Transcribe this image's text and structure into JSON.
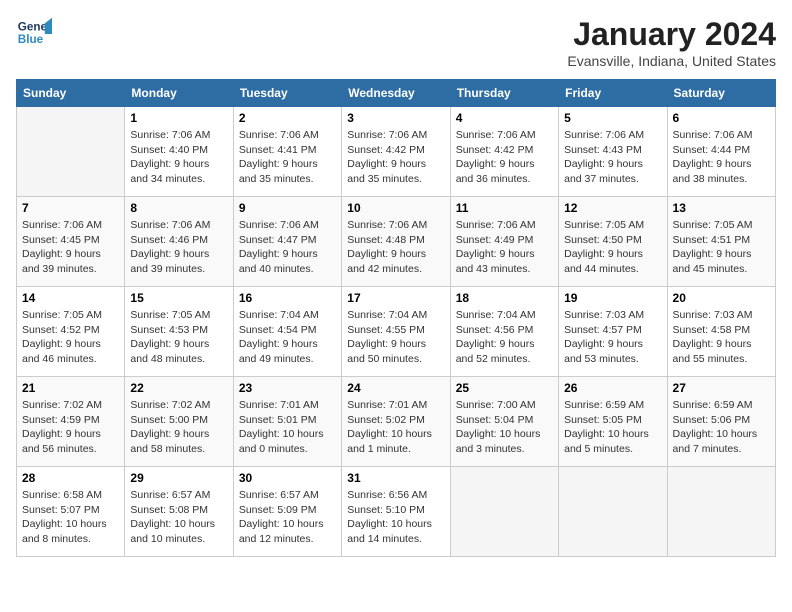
{
  "logo": {
    "line1": "General",
    "line2": "Blue"
  },
  "title": "January 2024",
  "subtitle": "Evansville, Indiana, United States",
  "weekdays": [
    "Sunday",
    "Monday",
    "Tuesday",
    "Wednesday",
    "Thursday",
    "Friday",
    "Saturday"
  ],
  "weeks": [
    [
      {
        "day": "",
        "info": ""
      },
      {
        "day": "1",
        "info": "Sunrise: 7:06 AM\nSunset: 4:40 PM\nDaylight: 9 hours\nand 34 minutes."
      },
      {
        "day": "2",
        "info": "Sunrise: 7:06 AM\nSunset: 4:41 PM\nDaylight: 9 hours\nand 35 minutes."
      },
      {
        "day": "3",
        "info": "Sunrise: 7:06 AM\nSunset: 4:42 PM\nDaylight: 9 hours\nand 35 minutes."
      },
      {
        "day": "4",
        "info": "Sunrise: 7:06 AM\nSunset: 4:42 PM\nDaylight: 9 hours\nand 36 minutes."
      },
      {
        "day": "5",
        "info": "Sunrise: 7:06 AM\nSunset: 4:43 PM\nDaylight: 9 hours\nand 37 minutes."
      },
      {
        "day": "6",
        "info": "Sunrise: 7:06 AM\nSunset: 4:44 PM\nDaylight: 9 hours\nand 38 minutes."
      }
    ],
    [
      {
        "day": "7",
        "info": ""
      },
      {
        "day": "8",
        "info": "Sunrise: 7:06 AM\nSunset: 4:46 PM\nDaylight: 9 hours\nand 39 minutes."
      },
      {
        "day": "9",
        "info": "Sunrise: 7:06 AM\nSunset: 4:47 PM\nDaylight: 9 hours\nand 40 minutes."
      },
      {
        "day": "10",
        "info": "Sunrise: 7:06 AM\nSunset: 4:48 PM\nDaylight: 9 hours\nand 42 minutes."
      },
      {
        "day": "11",
        "info": "Sunrise: 7:06 AM\nSunset: 4:49 PM\nDaylight: 9 hours\nand 43 minutes."
      },
      {
        "day": "12",
        "info": "Sunrise: 7:05 AM\nSunset: 4:50 PM\nDaylight: 9 hours\nand 44 minutes."
      },
      {
        "day": "13",
        "info": "Sunrise: 7:05 AM\nSunset: 4:51 PM\nDaylight: 9 hours\nand 45 minutes."
      }
    ],
    [
      {
        "day": "14",
        "info": ""
      },
      {
        "day": "15",
        "info": "Sunrise: 7:05 AM\nSunset: 4:53 PM\nDaylight: 9 hours\nand 48 minutes."
      },
      {
        "day": "16",
        "info": "Sunrise: 7:04 AM\nSunset: 4:54 PM\nDaylight: 9 hours\nand 49 minutes."
      },
      {
        "day": "17",
        "info": "Sunrise: 7:04 AM\nSunset: 4:55 PM\nDaylight: 9 hours\nand 50 minutes."
      },
      {
        "day": "18",
        "info": "Sunrise: 7:04 AM\nSunset: 4:56 PM\nDaylight: 9 hours\nand 52 minutes."
      },
      {
        "day": "19",
        "info": "Sunrise: 7:03 AM\nSunset: 4:57 PM\nDaylight: 9 hours\nand 53 minutes."
      },
      {
        "day": "20",
        "info": "Sunrise: 7:03 AM\nSunset: 4:58 PM\nDaylight: 9 hours\nand 55 minutes."
      }
    ],
    [
      {
        "day": "21",
        "info": ""
      },
      {
        "day": "22",
        "info": "Sunrise: 7:02 AM\nSunset: 5:00 PM\nDaylight: 9 hours\nand 58 minutes."
      },
      {
        "day": "23",
        "info": "Sunrise: 7:01 AM\nSunset: 5:01 PM\nDaylight: 10 hours\nand 0 minutes."
      },
      {
        "day": "24",
        "info": "Sunrise: 7:01 AM\nSunset: 5:02 PM\nDaylight: 10 hours\nand 1 minute."
      },
      {
        "day": "25",
        "info": "Sunrise: 7:00 AM\nSunset: 5:04 PM\nDaylight: 10 hours\nand 3 minutes."
      },
      {
        "day": "26",
        "info": "Sunrise: 6:59 AM\nSunset: 5:05 PM\nDaylight: 10 hours\nand 5 minutes."
      },
      {
        "day": "27",
        "info": "Sunrise: 6:59 AM\nSunset: 5:06 PM\nDaylight: 10 hours\nand 7 minutes."
      }
    ],
    [
      {
        "day": "28",
        "info": ""
      },
      {
        "day": "29",
        "info": "Sunrise: 6:57 AM\nSunset: 5:08 PM\nDaylight: 10 hours\nand 10 minutes."
      },
      {
        "day": "30",
        "info": "Sunrise: 6:57 AM\nSunset: 5:09 PM\nDaylight: 10 hours\nand 12 minutes."
      },
      {
        "day": "31",
        "info": "Sunrise: 6:56 AM\nSunset: 5:10 PM\nDaylight: 10 hours\nand 14 minutes."
      },
      {
        "day": "",
        "info": ""
      },
      {
        "day": "",
        "info": ""
      },
      {
        "day": "",
        "info": ""
      }
    ]
  ],
  "week1_sunday_info": "Sunrise: 7:06 AM\nSunset: 4:45 PM\nDaylight: 9 hours\nand 39 minutes.",
  "week3_sunday_info": "Sunrise: 7:05 AM\nSunset: 4:52 PM\nDaylight: 9 hours\nand 46 minutes.",
  "week4_sunday_info": "Sunrise: 7:02 AM\nSunset: 4:59 PM\nDaylight: 9 hours\nand 56 minutes.",
  "week5_sunday_info": "Sunrise: 6:58 AM\nSunset: 5:07 PM\nDaylight: 10 hours\nand 8 minutes."
}
